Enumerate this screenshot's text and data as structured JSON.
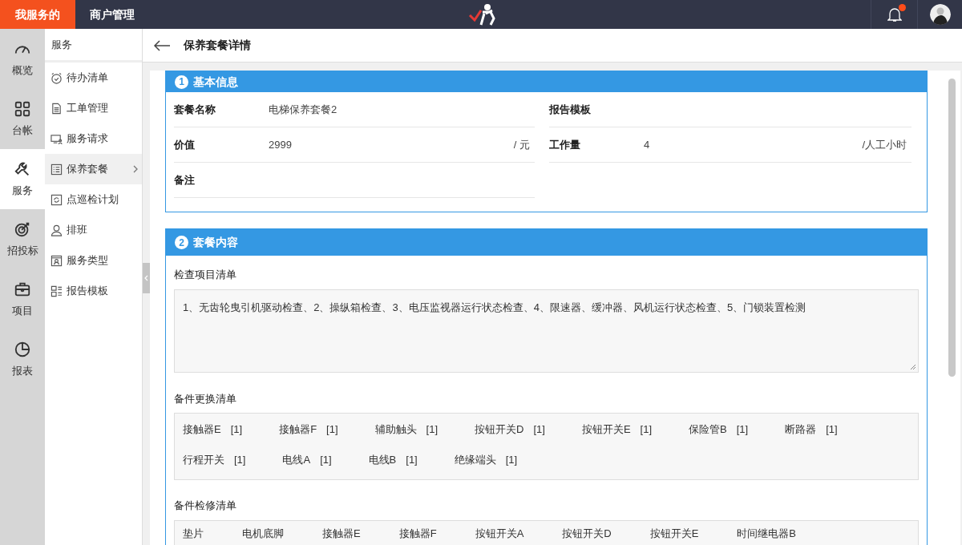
{
  "top_nav": [
    {
      "label": "我服务的",
      "selected": true
    },
    {
      "label": "商户管理",
      "selected": false
    }
  ],
  "notifications": {
    "unread": true
  },
  "rail": [
    {
      "label": "概览",
      "selected": false
    },
    {
      "label": "台帐",
      "selected": false
    },
    {
      "label": "服务",
      "selected": true
    },
    {
      "label": "招投标",
      "selected": false
    },
    {
      "label": "项目",
      "selected": false
    },
    {
      "label": "报表",
      "selected": false
    }
  ],
  "submenu": {
    "title": "服务",
    "items": [
      {
        "label": "待办清单",
        "selected": false
      },
      {
        "label": "工单管理",
        "selected": false
      },
      {
        "label": "服务请求",
        "selected": false
      },
      {
        "label": "保养套餐",
        "selected": true
      },
      {
        "label": "点巡检计划",
        "selected": false
      },
      {
        "label": "排班",
        "selected": false
      },
      {
        "label": "服务类型",
        "selected": false
      },
      {
        "label": "报告模板",
        "selected": false
      }
    ]
  },
  "page_title": "保养套餐详情",
  "basic_info": {
    "number": "1",
    "title": "基本信息",
    "left_fields": [
      {
        "label": "套餐名称",
        "value": "电梯保养套餐2"
      },
      {
        "label": "价值",
        "value": "2999",
        "unit": "/ 元"
      },
      {
        "label": "备注"
      }
    ],
    "right_fields": [
      {
        "label": "报告模板"
      },
      {
        "label": "工作量",
        "value": "4",
        "unit": "/人工小时"
      }
    ]
  },
  "package_content": {
    "number": "2",
    "title": "套餐内容",
    "inspection_label": "检查项目清单",
    "inspection_items": "1、无齿轮曳引机驱动检查、2、操纵箱检查、3、电压监视器运行状态检查、4、限速器、缓冲器、风机运行状态检查、5、门锁装置检测",
    "replacement_label": "备件更换清单",
    "replacement_parts": [
      {
        "name": "接触器E",
        "qty": "[1]"
      },
      {
        "name": "接触器F",
        "qty": "[1]"
      },
      {
        "name": "辅助触头",
        "qty": "[1]"
      },
      {
        "name": "按钮开关D",
        "qty": "[1]"
      },
      {
        "name": "按钮开关E",
        "qty": "[1]"
      },
      {
        "name": "保险管B",
        "qty": "[1]"
      },
      {
        "name": "断路器",
        "qty": "[1]"
      },
      {
        "name": "行程开关",
        "qty": "[1]"
      },
      {
        "name": "电线A",
        "qty": "[1]"
      },
      {
        "name": "电线B",
        "qty": "[1]"
      },
      {
        "name": "绝缘端头",
        "qty": "[1]"
      }
    ],
    "repair_label": "备件检修清单",
    "repair_parts": [
      "垫片",
      "电机底脚",
      "接触器E",
      "接触器F",
      "按钮开关A",
      "按钮开关D",
      "按钮开关E",
      "时间继电器B"
    ]
  }
}
